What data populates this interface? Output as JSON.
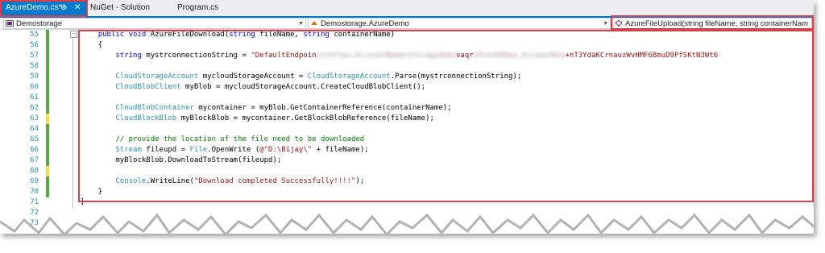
{
  "tabs": [
    {
      "label": "AzureDemo.cs*",
      "pin": "⊕",
      "close": "✕"
    },
    {
      "label": "NuGet - Solution"
    },
    {
      "label": "Program.cs"
    }
  ],
  "navbar": {
    "project": "Demostorage",
    "class": "Demostorage.AzureDemo",
    "member": "AzureFileUpload(string fileName, string containerNam"
  },
  "code_lines": [
    {
      "n": "55",
      "change": "green",
      "tokens": [
        [
          "",
          "    "
        ],
        [
          "kw",
          "public"
        ],
        [
          "",
          " "
        ],
        [
          "kw",
          "void"
        ],
        [
          "",
          " AzureFileDownload("
        ],
        [
          "kw",
          "string"
        ],
        [
          "",
          " fileName, "
        ],
        [
          "kw",
          "string"
        ],
        [
          "",
          " containerName)"
        ]
      ]
    },
    {
      "n": "56",
      "change": "green",
      "tokens": [
        [
          "",
          "    {"
        ]
      ]
    },
    {
      "n": "57",
      "change": "green",
      "tokens": [
        [
          "",
          "        "
        ],
        [
          "kw",
          "string"
        ],
        [
          "",
          " mystrconnectionString = "
        ],
        [
          "st",
          "\"DefaultEndpoin"
        ],
        [
          "blur",
          "ts=https;AccountName=storagedemo"
        ],
        [
          "st",
          "vaqr"
        ],
        [
          "blur",
          "uTvozk8mwe_AccountKey"
        ],
        [
          "st",
          "+nT3YdaKCrnauzWvHMF6BmuD9PfSKtN3Wt6"
        ]
      ]
    },
    {
      "n": "58",
      "change": "green",
      "tokens": [
        [
          "",
          ""
        ]
      ]
    },
    {
      "n": "59",
      "change": "green",
      "tokens": [
        [
          "",
          "        "
        ],
        [
          "ty",
          "CloudStorageAccount"
        ],
        [
          "",
          " mycloudStorageAccount = "
        ],
        [
          "ty",
          "CloudStorageAccount"
        ],
        [
          "",
          ".Parse(mystrconnectionString);"
        ]
      ]
    },
    {
      "n": "60",
      "change": "green",
      "tokens": [
        [
          "",
          "        "
        ],
        [
          "ty",
          "CloudBlobClient"
        ],
        [
          "",
          " myBlob = mycloudStorageAccount.CreateCloudBlobClient();"
        ]
      ]
    },
    {
      "n": "61",
      "change": "green",
      "tokens": [
        [
          "",
          ""
        ]
      ]
    },
    {
      "n": "62",
      "change": "green",
      "tokens": [
        [
          "",
          "        "
        ],
        [
          "ty",
          "CloudBlobContainer"
        ],
        [
          "",
          " mycontainer = myBlob.GetContainerReference(containerName);"
        ]
      ]
    },
    {
      "n": "63",
      "change": "yellow",
      "tokens": [
        [
          "",
          "        "
        ],
        [
          "ty",
          "CloudBlockBlob"
        ],
        [
          "",
          " myBlockBlob = mycontainer.GetBlockBlobReference(fileName);"
        ]
      ]
    },
    {
      "n": "64",
      "change": "green",
      "tokens": [
        [
          "",
          ""
        ]
      ]
    },
    {
      "n": "65",
      "change": "green",
      "tokens": [
        [
          "",
          "        "
        ],
        [
          "cm",
          "// provide the location of the file need to be downloaded"
        ]
      ]
    },
    {
      "n": "66",
      "change": "green",
      "tokens": [
        [
          "",
          "        "
        ],
        [
          "ty",
          "Stream"
        ],
        [
          "",
          " fileupd = "
        ],
        [
          "ty",
          "File"
        ],
        [
          "",
          ".OpenWrite ("
        ],
        [
          "st",
          "@\"D:\\Bijay\\\""
        ],
        [
          "",
          " + fileName);"
        ]
      ]
    },
    {
      "n": "67",
      "change": "green",
      "tokens": [
        [
          "",
          "        myBlockBlob.DownloadToStream(fileupd);"
        ]
      ]
    },
    {
      "n": "68",
      "change": "yellow",
      "tokens": [
        [
          "",
          ""
        ]
      ]
    },
    {
      "n": "69",
      "change": "green",
      "tokens": [
        [
          "",
          "        "
        ],
        [
          "ty",
          "Console"
        ],
        [
          "",
          ".WriteLine("
        ],
        [
          "st",
          "\"Download completed Successfully!!!!\""
        ],
        [
          "",
          ");"
        ]
      ]
    },
    {
      "n": "70",
      "change": "green",
      "tokens": [
        [
          "",
          "    }"
        ]
      ]
    },
    {
      "n": "71",
      "change": "",
      "tokens": [
        [
          "",
          "}"
        ]
      ]
    },
    {
      "n": "72",
      "change": "",
      "tokens": [
        [
          "",
          ""
        ]
      ]
    },
    {
      "n": "73",
      "change": "",
      "tokens": [
        [
          "",
          ""
        ]
      ]
    }
  ],
  "colors": {
    "accent": "#007acc",
    "highlight": "#e03e47",
    "change_green": "#57a64a",
    "change_yellow": "#f2e04a"
  }
}
